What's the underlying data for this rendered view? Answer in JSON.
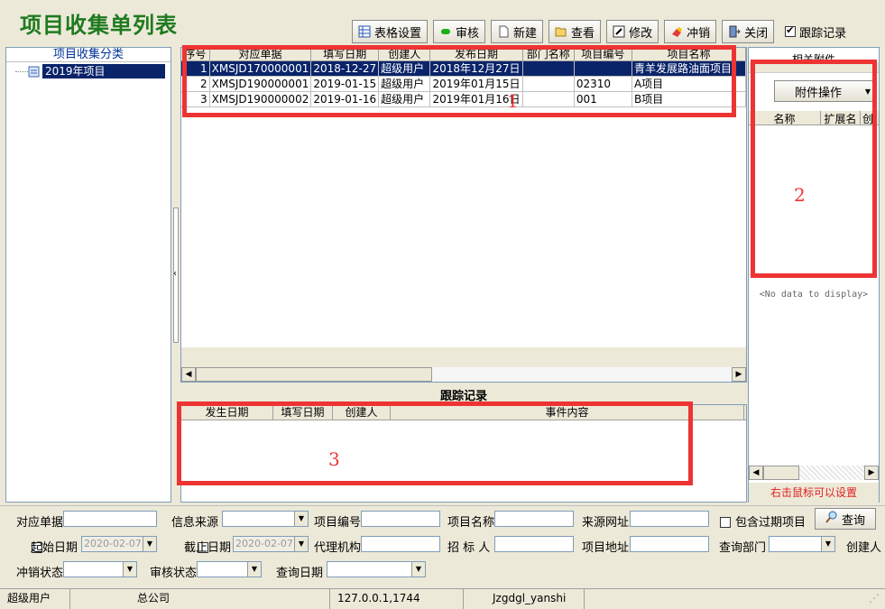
{
  "window": {
    "title": "项目收集单列表"
  },
  "toolbar": {
    "buttons": [
      {
        "label": "表格设置",
        "icon": "grid-settings-icon"
      },
      {
        "label": "审核",
        "icon": "green-dot-icon"
      },
      {
        "label": "新建",
        "icon": "new-document-icon"
      },
      {
        "label": "查看",
        "icon": "folder-open-icon"
      },
      {
        "label": "修改",
        "icon": "edit-icon"
      },
      {
        "label": "冲销",
        "icon": "eraser-icon"
      },
      {
        "label": "关闭",
        "icon": "exit-icon"
      }
    ],
    "trace_checkbox": {
      "label": "跟踪记录",
      "checked": true
    }
  },
  "left_panel": {
    "header": "项目收集分类",
    "tree": [
      {
        "label": "2019年项目",
        "selected": true
      }
    ]
  },
  "main_grid": {
    "columns": [
      "序号",
      "对应单据",
      "填写日期",
      "创建人",
      "发布日期",
      "部门名称",
      "项目编号",
      "项目名称"
    ],
    "rows": [
      {
        "no": "1",
        "doc": "XMSJD170000001",
        "fill_date": "2018-12-27",
        "creator": "超级用户",
        "publish_date": "2018年12月27日",
        "dept": "",
        "code": "",
        "name": "青羊发展路油面项目",
        "selected": true
      },
      {
        "no": "2",
        "doc": "XMSJD190000001",
        "fill_date": "2019-01-15",
        "creator": "超级用户",
        "publish_date": "2019年01月15日",
        "dept": "",
        "code": "02310",
        "name": "A项目",
        "selected": false
      },
      {
        "no": "3",
        "doc": "XMSJD190000002",
        "fill_date": "2019-01-16",
        "creator": "超级用户",
        "publish_date": "2019年01月16日",
        "dept": "",
        "code": "001",
        "name": "B项目",
        "selected": false
      }
    ]
  },
  "right_panel": {
    "header": "相关附件",
    "attach_button": "附件操作",
    "columns": [
      "名称",
      "扩展名",
      "创"
    ],
    "empty_text": "<No data to display>",
    "hint": "右击鼠标可以设置"
  },
  "trace": {
    "title": "跟踪记录",
    "columns": [
      "发生日期",
      "填写日期",
      "创建人",
      "事件内容"
    ]
  },
  "annotations": {
    "box1": "1",
    "box2": "2",
    "box3": "3"
  },
  "filters": {
    "doc_label": "对应单据",
    "source_label": "信息来源",
    "code_label": "项目编号",
    "name_label": "项目名称",
    "url_label": "来源网址",
    "expired_label": "包含过期项目",
    "query_button": "查询",
    "start_label": "起始日期",
    "start_value": "2020-02-07",
    "end_label": "截止日期",
    "end_value": "2020-02-07",
    "agent_label": "代理机构",
    "bidder_label": "招 标 人",
    "address_label": "项目地址",
    "dept_label": "查询部门",
    "creator_label": "创建人",
    "writeoff_label": "冲销状态",
    "audit_label": "审核状态",
    "date_label": "查询日期"
  },
  "status_bar": {
    "user": "超级用户",
    "company": "总公司",
    "ip": "127.0.0.1,1744",
    "db": "Jzgdgl_yanshi"
  }
}
